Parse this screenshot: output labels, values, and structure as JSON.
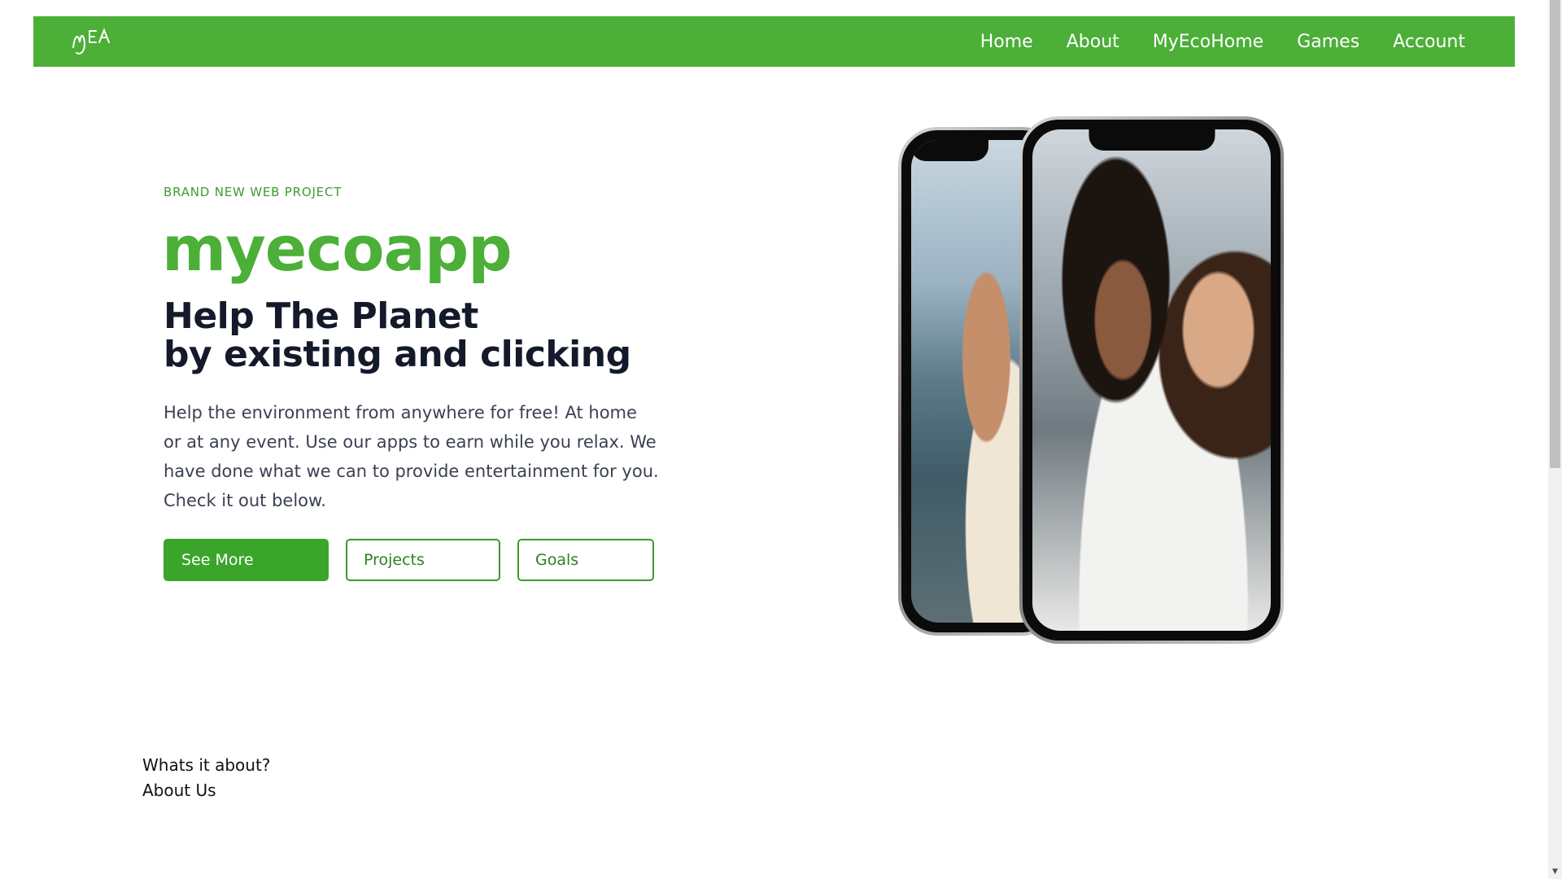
{
  "navbar": {
    "logo_text": "MEA",
    "links": [
      "Home",
      "About",
      "MyEcoHome",
      "Games",
      "Account"
    ]
  },
  "hero": {
    "eyebrow": "BRAND NEW WEB PROJECT",
    "brand": "myecoapp",
    "headline_line1": "Help The Planet",
    "headline_line2": "by existing and clicking",
    "description": "Help the environment from anywhere for free! At home or at any event. Use our apps to earn while you relax. We have done what we can to provide entertainment for you. Check it out below.",
    "buttons": {
      "primary": "See More",
      "projects": "Projects",
      "goals": "Goals"
    }
  },
  "about": {
    "kicker": "Whats it about?",
    "title": "About Us"
  },
  "colors": {
    "brand_green": "#4caf38",
    "headline_dark": "#141a2b"
  },
  "icons": {
    "scroll_up": "▲",
    "scroll_down": "▼"
  }
}
